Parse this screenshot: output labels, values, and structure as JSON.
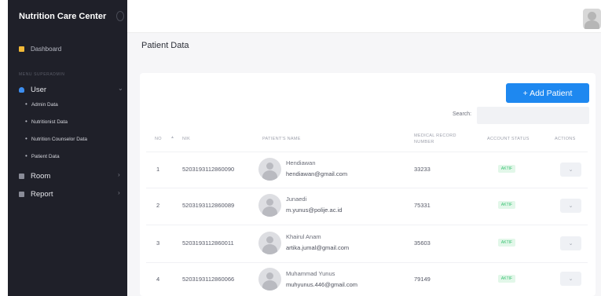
{
  "sidebar": {
    "brand": "Nutrition Care Center",
    "dashboard_label": "Dashboard",
    "section_label": "MENU SUPERADMIN",
    "user_label": "User",
    "sub_items": [
      "Admin Data",
      "Nutritionist Data",
      "Nutrition Counselor Data",
      "Patient Data"
    ],
    "room_label": "Room",
    "report_label": "Report"
  },
  "page": {
    "title": "Patient Data"
  },
  "toolbar": {
    "add_patient_label": "+ Add Patient",
    "search_label": "Search:",
    "search_value": ""
  },
  "table": {
    "headers": {
      "no": "NO",
      "nik": "NIK",
      "patient_name": "PATIENT'S NAME",
      "mrn_line1": "MEDICAL RECORD",
      "mrn_line2": "NUMBER",
      "account_status": "ACCOUNT STATUS",
      "actions": "ACTIONS"
    },
    "rows": [
      {
        "no": "1",
        "nik": "5203193112860090",
        "name": "Hendiawan",
        "email": "hendiawan@gmail.com",
        "mrn": "33233",
        "status": "AKTIF"
      },
      {
        "no": "2",
        "nik": "5203193112860089",
        "name": "Junaedi",
        "email": "m.yunus@polije.ac.id",
        "mrn": "75331",
        "status": "AKTIF"
      },
      {
        "no": "3",
        "nik": "5203193112860011",
        "name": "Khairul Anam",
        "email": "artika.jumal@gmail.com",
        "mrn": "35603",
        "status": "AKTIF"
      },
      {
        "no": "4",
        "nik": "5203193112860066",
        "name": "Muhammad Yunus",
        "email": "muhyunus.446@gmail.com",
        "mrn": "79149",
        "status": "AKTIF"
      }
    ]
  },
  "colors": {
    "sidebar_bg": "#1f2029",
    "accent": "#1e88f0",
    "status_text": "#38c172",
    "status_bg": "#e2f7e9"
  },
  "icons": {
    "dashboard": "dashboard-icon",
    "user": "user-icon",
    "room": "room-icon",
    "report": "report-icon",
    "action": "chevron-down-icon"
  }
}
